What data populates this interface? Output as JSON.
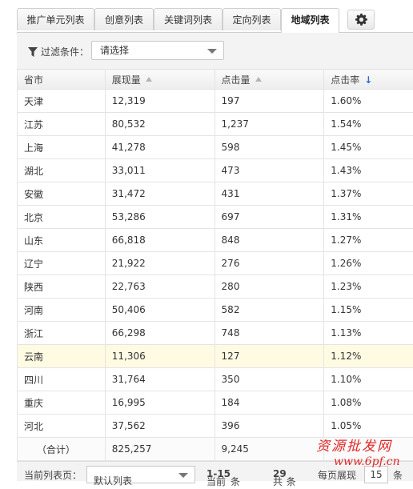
{
  "tabs": [
    {
      "label": "推广单元列表"
    },
    {
      "label": "创意列表"
    },
    {
      "label": "关键词列表"
    },
    {
      "label": "定向列表"
    },
    {
      "label": "地域列表"
    }
  ],
  "filter": {
    "label": "过滤条件：",
    "select_value": "请选择"
  },
  "table": {
    "headers": [
      "省市",
      "展现量",
      "点击量",
      "点击率"
    ],
    "rows": [
      [
        "天津",
        "12,319",
        "197",
        "1.60%"
      ],
      [
        "江苏",
        "80,532",
        "1,237",
        "1.54%"
      ],
      [
        "上海",
        "41,278",
        "598",
        "1.45%"
      ],
      [
        "湖北",
        "33,011",
        "473",
        "1.43%"
      ],
      [
        "安徽",
        "31,472",
        "431",
        "1.37%"
      ],
      [
        "北京",
        "53,286",
        "697",
        "1.31%"
      ],
      [
        "山东",
        "66,818",
        "848",
        "1.27%"
      ],
      [
        "辽宁",
        "21,922",
        "276",
        "1.26%"
      ],
      [
        "陕西",
        "22,763",
        "280",
        "1.23%"
      ],
      [
        "河南",
        "50,406",
        "582",
        "1.15%"
      ],
      [
        "浙江",
        "66,298",
        "748",
        "1.13%"
      ],
      [
        "云南",
        "11,306",
        "127",
        "1.12%"
      ],
      [
        "四川",
        "31,764",
        "350",
        "1.10%"
      ],
      [
        "重庆",
        "16,995",
        "184",
        "1.08%"
      ],
      [
        "河北",
        "37,562",
        "396",
        "1.05%"
      ]
    ],
    "total": [
      "（合计）",
      "825,257",
      "9,245",
      ""
    ]
  },
  "footer": {
    "view_label": "当前列表页：",
    "view_value": "默认列表",
    "range_prefix": "当前",
    "range": "1-15",
    "range_suffix": "条",
    "total_prefix": "共",
    "total": "29",
    "total_suffix": "条",
    "perpage_label": "每页展现",
    "perpage_value": "15",
    "perpage_suffix": "条"
  },
  "watermark": {
    "line1": "资源批发网",
    "line2": "www.6pf.cn"
  },
  "colors": {
    "accent": "#2a6fc9",
    "highlight_row": "#fffbe3",
    "watermark": "#e12828"
  },
  "icons": {
    "filter": "funnel-icon",
    "settings": "gear-icon",
    "sort_asc": "sort-up-icon",
    "sort_desc": "arrow-down-icon"
  }
}
